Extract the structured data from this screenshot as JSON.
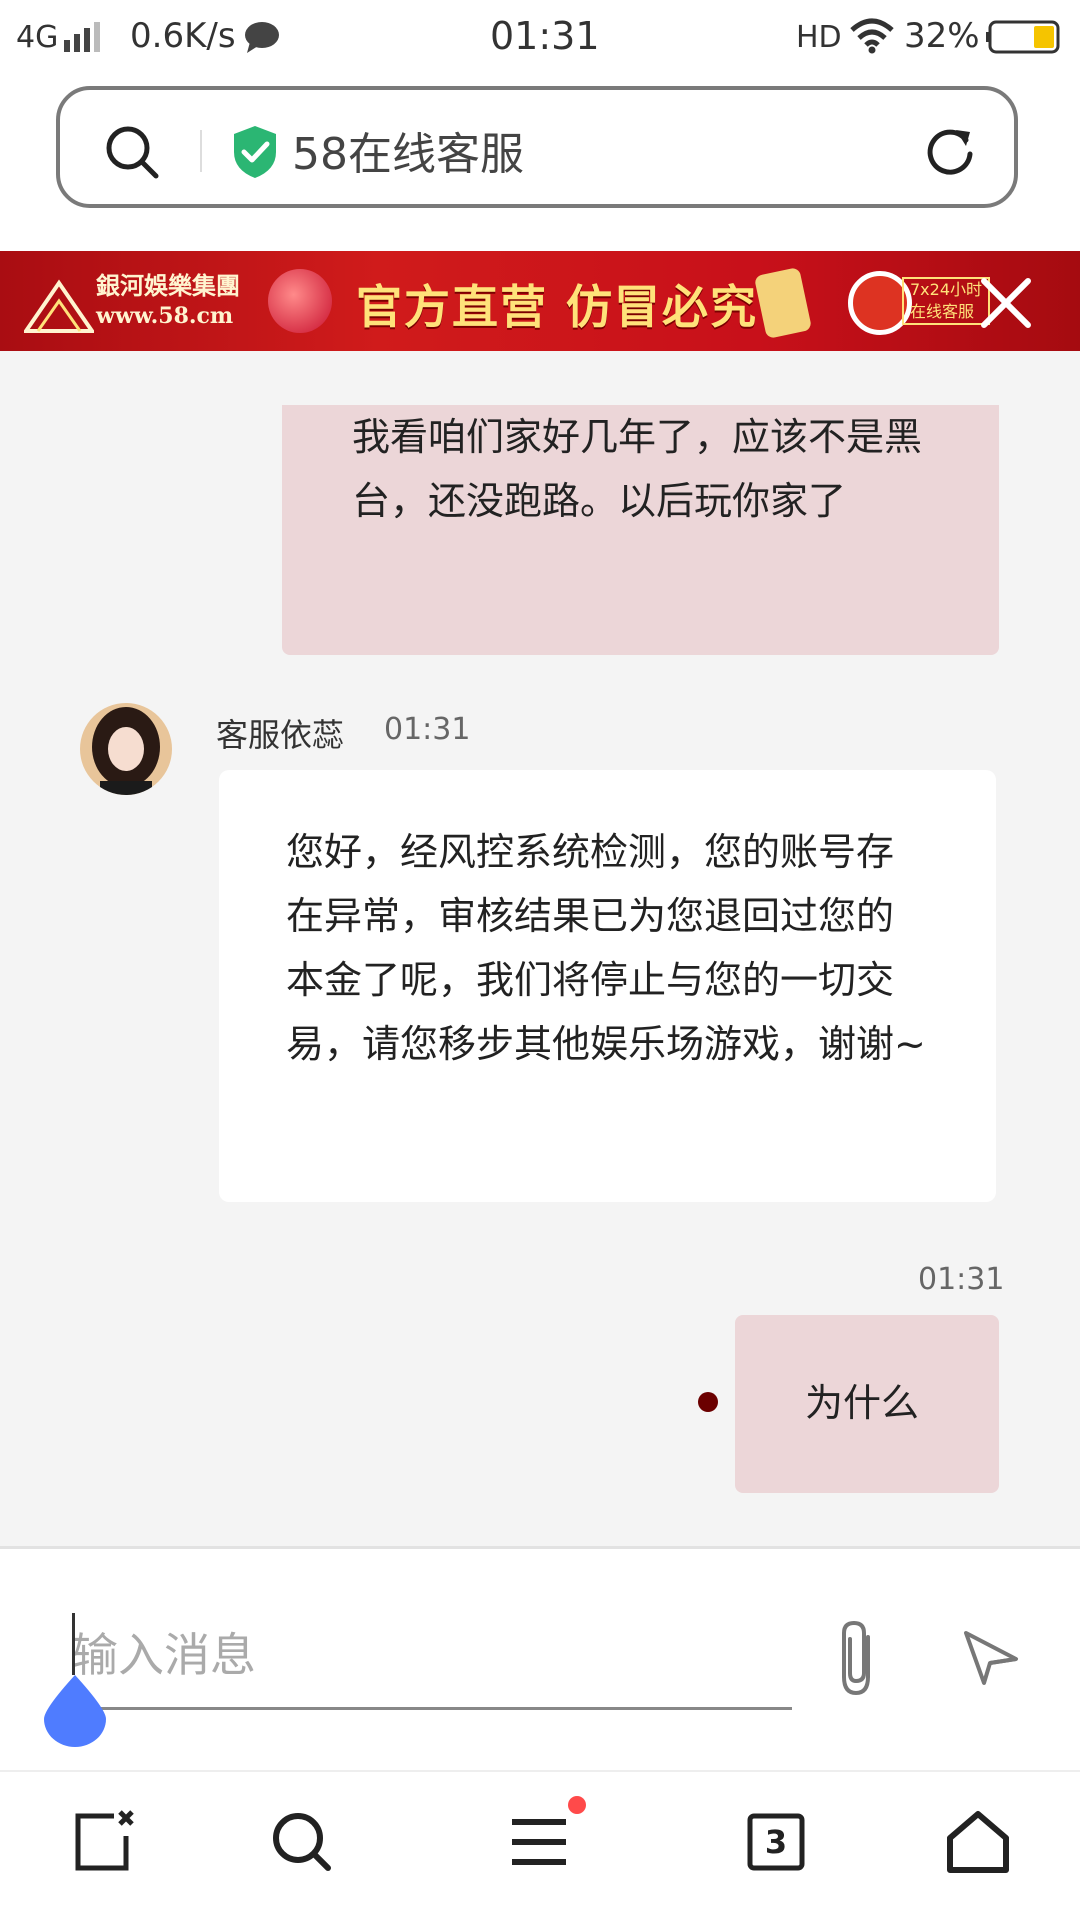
{
  "status_bar": {
    "network": "4G",
    "speed": "0.6K/s",
    "time": "01:31",
    "hd": "HD",
    "battery": "32%"
  },
  "browser": {
    "page_title": "58在线客服"
  },
  "banner": {
    "logo_name": "銀河娛樂集團",
    "logo_url": "www.58.cm",
    "slogan": "官方直营  仿冒必究",
    "badge_line1": "7x24小时",
    "badge_line2": "在线客服"
  },
  "chat": {
    "messages": [
      {
        "from": "user",
        "text": "我看咱们家好几年了，应该不是黑台，还没跑路。以后玩你家了"
      },
      {
        "from": "agent",
        "name": "客服依蕊",
        "time": "01:31",
        "text": "您好，经风控系统检测，您的账号存在异常，审核结果已为您退回过您的本金了呢，我们将停止与您的一切交易，请您移步其他娱乐场游戏，谢谢~"
      },
      {
        "from": "user",
        "time": "01:31",
        "text": "为什么"
      }
    ]
  },
  "composer": {
    "placeholder": "输入消息"
  },
  "bottom_nav": {
    "tab_count": "3"
  },
  "colors": {
    "user_bubble": "#ecd6d8",
    "agent_bubble": "#ffffff",
    "secure_green": "#2bb673",
    "handle_blue": "#4f7cff",
    "notice_red": "#ff4a4a",
    "unread_dot": "#6b0000"
  },
  "icons": [
    "search-icon",
    "shield-check-icon",
    "refresh-icon",
    "close-icon",
    "attachment-icon",
    "send-icon",
    "new-tab-icon",
    "menu-icon",
    "tabs-icon",
    "home-icon"
  ]
}
